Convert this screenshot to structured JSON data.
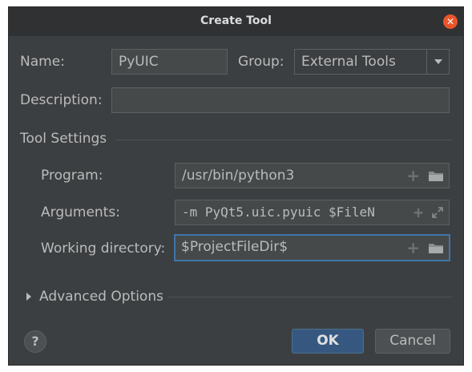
{
  "dialog": {
    "title": "Create Tool",
    "close_icon": "close-icon"
  },
  "form": {
    "name_label": "Name:",
    "name_value": "PyUIC",
    "group_label": "Group:",
    "group_value": "External Tools",
    "description_label": "Description:",
    "description_value": ""
  },
  "tool_settings": {
    "section_label": "Tool Settings",
    "program_label": "Program:",
    "program_value": "/usr/bin/python3",
    "arguments_label": "Arguments:",
    "arguments_value": "-m PyQt5.uic.pyuic $FileN",
    "working_dir_label": "Working directory:",
    "working_dir_value": "$ProjectFileDir$"
  },
  "advanced": {
    "label": "Advanced Options"
  },
  "footer": {
    "help_label": "?",
    "ok_label": "OK",
    "cancel_label": "Cancel"
  },
  "icons": {
    "add": "+",
    "colors": {
      "accent": "#365880",
      "focus": "#3f75a8",
      "close": "#e9552b",
      "background": "#3c3f41"
    }
  }
}
